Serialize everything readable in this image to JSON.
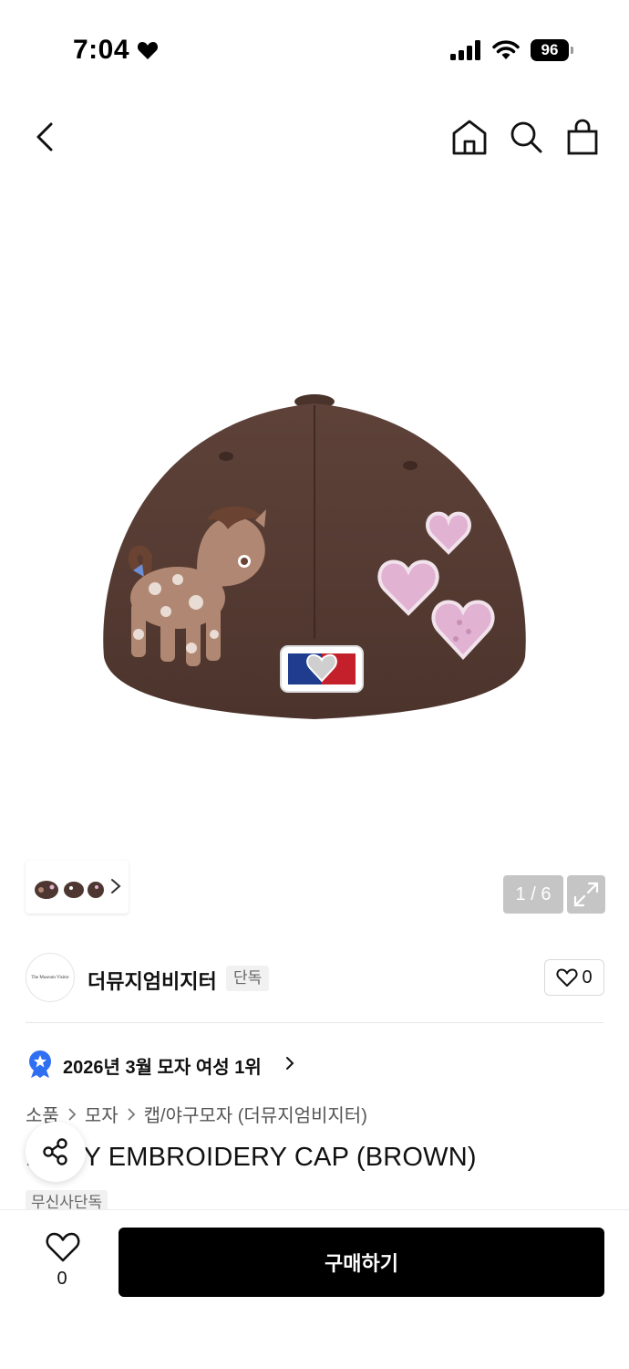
{
  "status_bar": {
    "time": "7:04",
    "battery": "96",
    "icons": [
      "heart-icon",
      "signal-icon",
      "wifi-icon",
      "battery-icon"
    ]
  },
  "nav": {
    "icons": [
      "back-arrow-icon",
      "home-icon",
      "search-icon",
      "shopping-bag-icon"
    ]
  },
  "gallery": {
    "counter": "1 / 6",
    "icons": [
      "chevron-right-icon",
      "expand-icon"
    ]
  },
  "brand": {
    "logo_text": "The Museum Visitor",
    "name": "더뮤지엄비지터",
    "badge": "단독",
    "like_count": "0"
  },
  "ranking": {
    "text": "2026년 3월 모자 여성 1위",
    "icon": "award-badge-icon",
    "badge_color": "#2f6ff2"
  },
  "breadcrumb": [
    "소품",
    "모자",
    "캡/야구모자 (더뮤지엄비지터)"
  ],
  "product": {
    "title": "PONY EMBROIDERY CAP (BROWN)",
    "exclusive_tag": "무신사단독"
  },
  "bottom_bar": {
    "like_count": "0",
    "buy_label": "구매하기"
  },
  "colors": {
    "cap_brown": "#5b3f36",
    "heart_pink": "#e3b1d3",
    "buy_button": "#000000"
  }
}
